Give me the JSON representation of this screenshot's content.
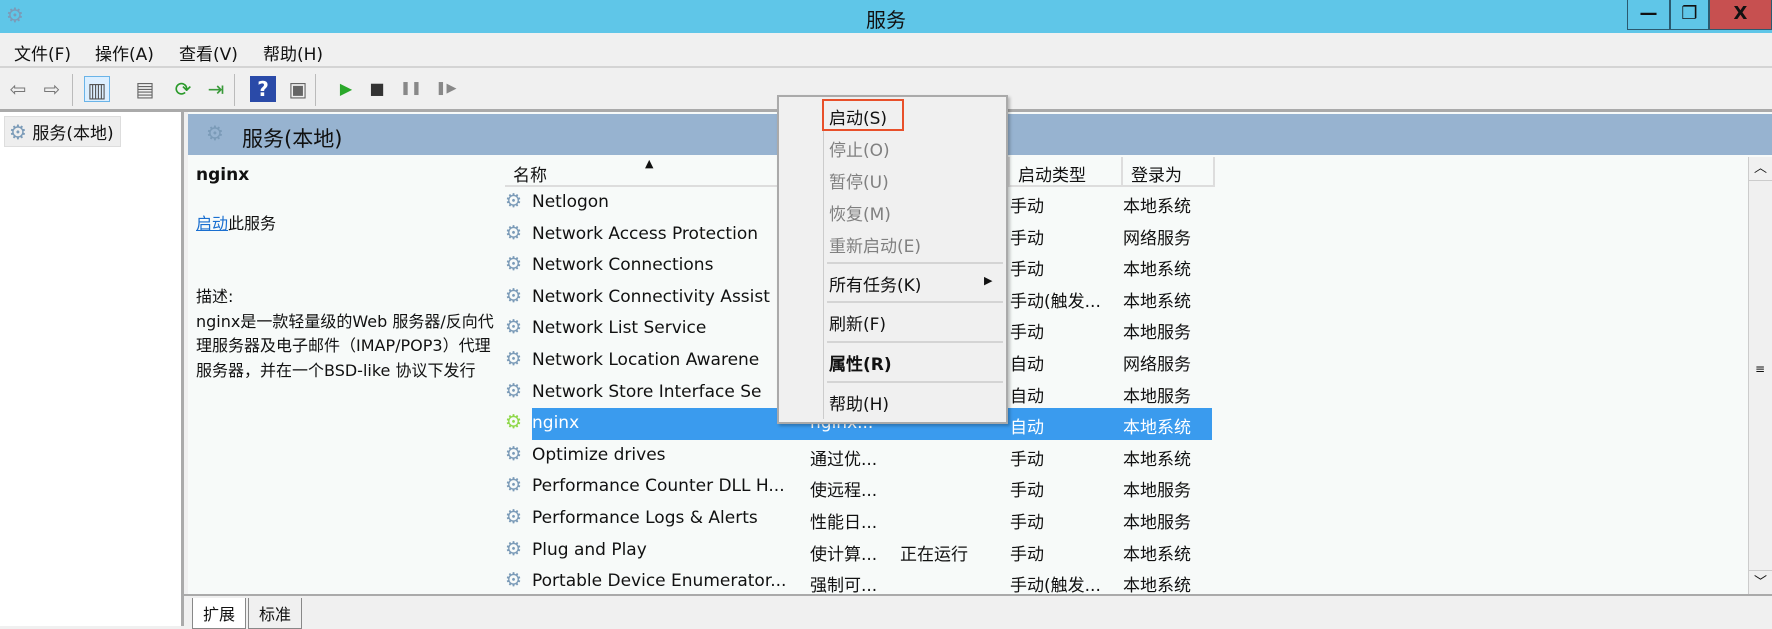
{
  "window": {
    "title": "服务",
    "minimize": "—",
    "restore": "❐",
    "close": "X"
  },
  "menubar": [
    "文件(F)",
    "操作(A)",
    "查看(V)",
    "帮助(H)"
  ],
  "toolbar": {
    "back": "⇦",
    "forward": "⇨",
    "console_tree": "▥",
    "properties": "▤",
    "refresh": "⟳",
    "export": "⇥",
    "help": "?",
    "action_pane": "▣",
    "start": "▶",
    "stop": "■",
    "pause": "❚❚",
    "resume": "❚▶"
  },
  "tree": {
    "item": "服务(本地)"
  },
  "pane": {
    "title": "服务(本地)"
  },
  "details": {
    "service_name": "nginx",
    "start_link": "启动",
    "start_suffix": "此服务",
    "desc_label": "描述:",
    "description": "nginx是一款轻量级的Web 服务器/反向代理服务器及电子邮件（IMAP/POP3）代理服务器，并在一个BSD-like 协议下发行"
  },
  "columns": {
    "name": "名称",
    "startup": "启动类型",
    "logon": "登录为"
  },
  "rows": [
    {
      "name": "Netlogon",
      "desc": "",
      "status": "",
      "startup": "手动",
      "logon": "本地系统"
    },
    {
      "name": "Network Access Protection",
      "desc": "",
      "status": "",
      "startup": "手动",
      "logon": "网络服务"
    },
    {
      "name": "Network Connections",
      "desc": "",
      "status": "",
      "startup": "手动",
      "logon": "本地系统"
    },
    {
      "name": "Network Connectivity Assist",
      "desc": "",
      "status": "",
      "startup": "手动(触发...",
      "logon": "本地系统"
    },
    {
      "name": "Network List Service",
      "desc": "",
      "status": "",
      "startup": "手动",
      "logon": "本地服务"
    },
    {
      "name": "Network Location Awarene",
      "desc": "",
      "status": "",
      "startup": "自动",
      "logon": "网络服务"
    },
    {
      "name": "Network Store Interface Se",
      "desc": "",
      "status": "",
      "startup": "自动",
      "logon": "本地服务"
    },
    {
      "name": "nginx",
      "desc": "nginx...",
      "status": "",
      "startup": "自动",
      "logon": "本地系统",
      "selected": true
    },
    {
      "name": "Optimize drives",
      "desc": "通过优...",
      "status": "",
      "startup": "手动",
      "logon": "本地系统"
    },
    {
      "name": "Performance Counter DLL H...",
      "desc": "使远程...",
      "status": "",
      "startup": "手动",
      "logon": "本地服务"
    },
    {
      "name": "Performance Logs & Alerts",
      "desc": "性能日...",
      "status": "",
      "startup": "手动",
      "logon": "本地服务"
    },
    {
      "name": "Plug and Play",
      "desc": "使计算...",
      "status": "正在运行",
      "startup": "手动",
      "logon": "本地系统"
    },
    {
      "name": "Portable Device Enumerator...",
      "desc": "强制可...",
      "status": "",
      "startup": "手动(触发...",
      "logon": "本地系统"
    }
  ],
  "context_menu": {
    "start": "启动(S)",
    "stop": "停止(O)",
    "pause": "暂停(U)",
    "resume": "恢复(M)",
    "restart": "重新启动(E)",
    "all_tasks": "所有任务(K)",
    "refresh": "刷新(F)",
    "properties": "属性(R)",
    "help": "帮助(H)"
  },
  "tabs": [
    "扩展",
    "标准"
  ],
  "colors": {
    "titlebar": "#5fc6e8",
    "close": "#c75050",
    "selection": "#3a9bee",
    "highlight_box": "#e8502a",
    "pane_header": "#97b3d0"
  }
}
